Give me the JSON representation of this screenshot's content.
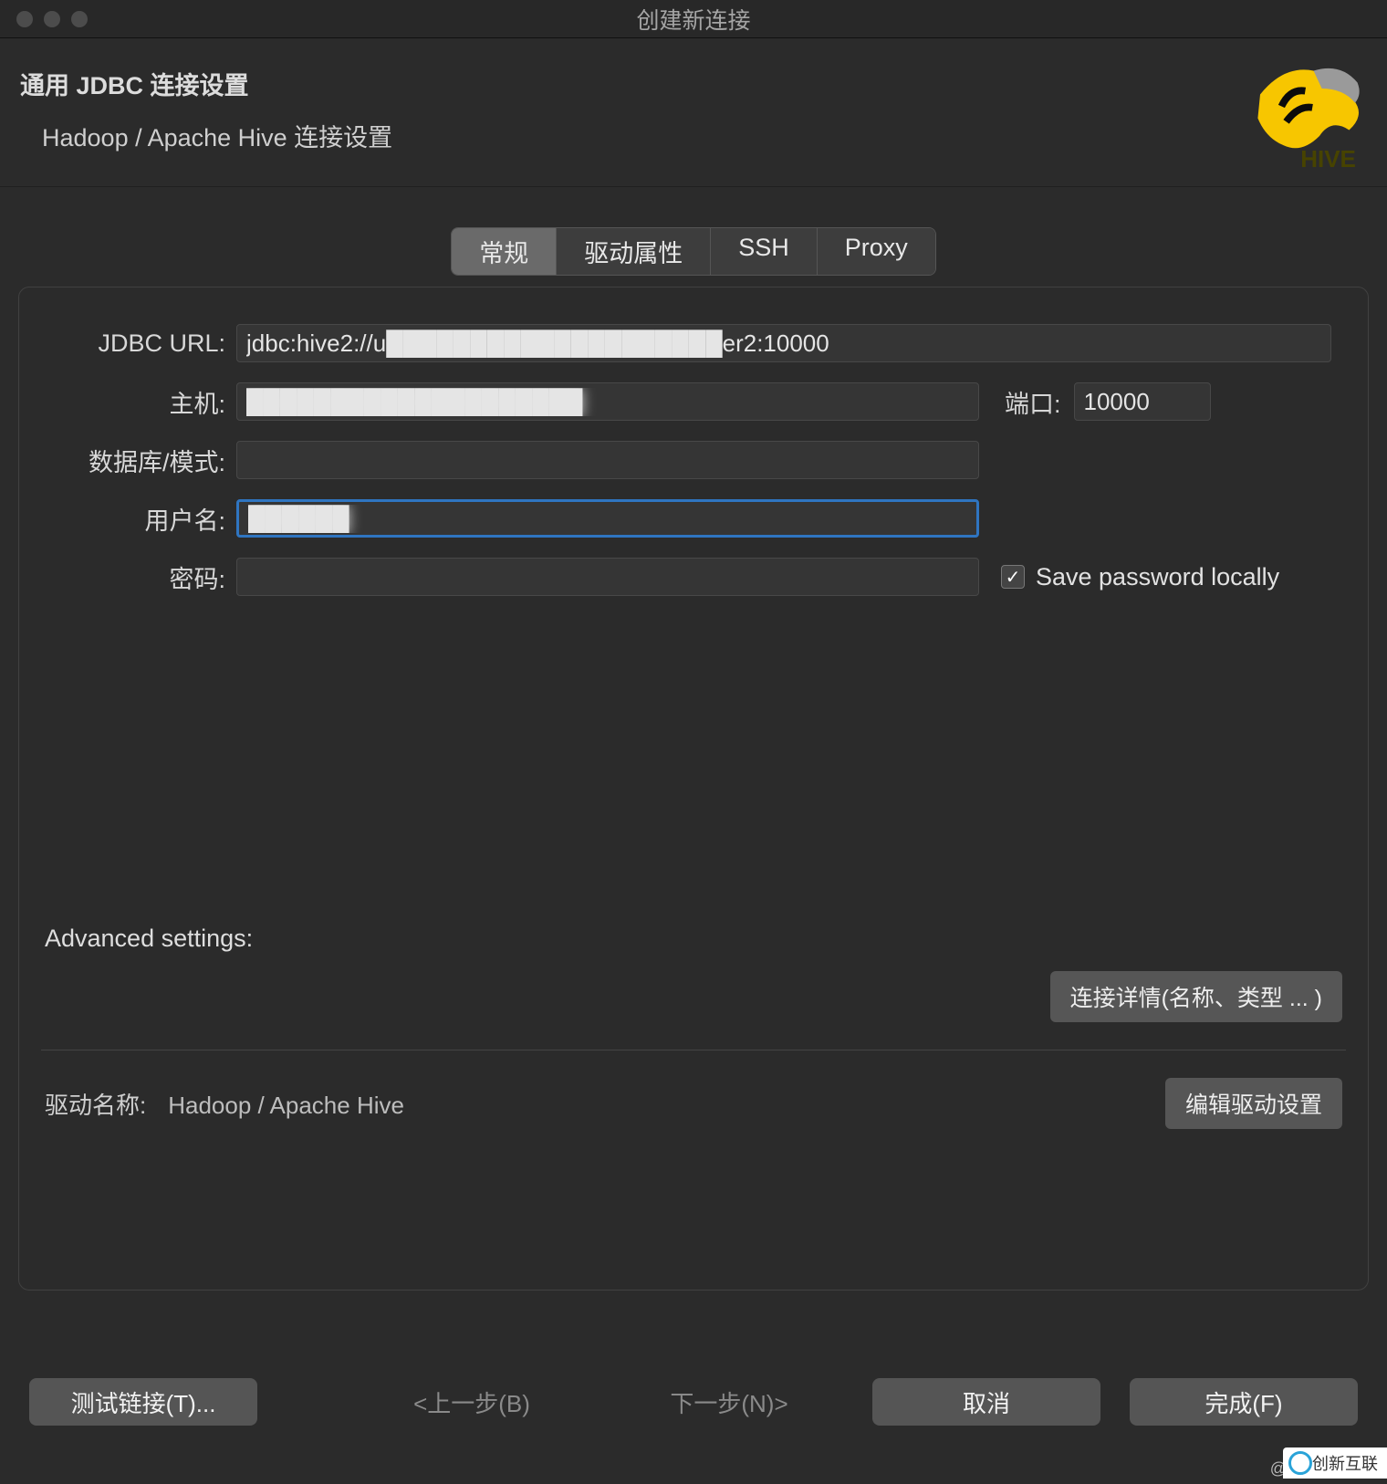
{
  "window": {
    "title": "创建新连接"
  },
  "header": {
    "title": "通用 JDBC 连接设置",
    "subtitle": "Hadoop / Apache Hive 连接设置"
  },
  "hive": {
    "label": "HIVE"
  },
  "tabs": [
    "常规",
    "驱动属性",
    "SSH",
    "Proxy"
  ],
  "labels": {
    "jdbc_url": "JDBC URL:",
    "host": "主机:",
    "port": "端口:",
    "database": "数据库/模式:",
    "username": "用户名:",
    "password": "密码:",
    "save_pw": "Save password locally",
    "advanced": "Advanced settings:",
    "conn_detail": "连接详情(名称、类型 ... )",
    "driver_label": "驱动名称:",
    "driver_name": "Hadoop / Apache Hive",
    "edit_driver": "编辑驱动设置"
  },
  "values": {
    "jdbc_url": "jdbc:hive2://u████████████████████er2:10000",
    "host": "████████████████████",
    "port": "10000",
    "database": "",
    "username": "██████",
    "password": ""
  },
  "footer": {
    "test": "测试链接(T)...",
    "prev": "<上一步(B)",
    "next": "下一步(N)>",
    "cancel": "取消",
    "finish": "完成(F)"
  },
  "watermark": {
    "at": "@5",
    "text": "创新互联"
  }
}
